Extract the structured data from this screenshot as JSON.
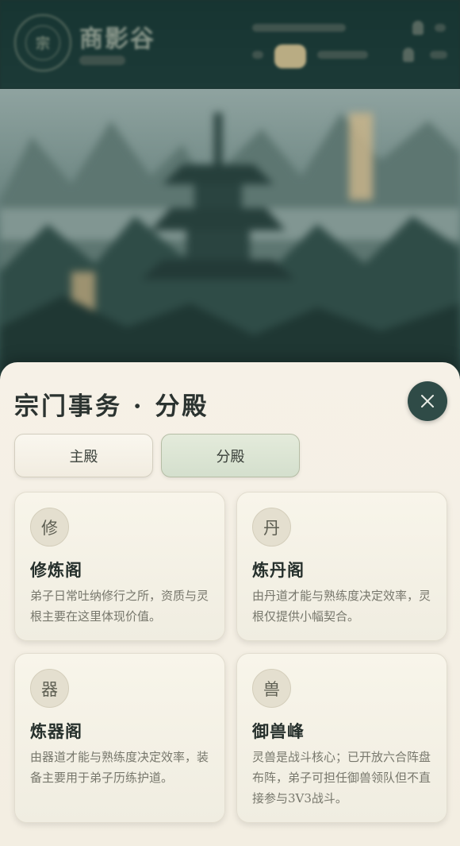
{
  "header": {
    "emblem_glyph": "宗",
    "sect_name": "商影谷"
  },
  "sheet": {
    "title": "宗门事务 · 分殿",
    "close_icon": "close-icon",
    "tabs": [
      {
        "label": "主殿",
        "active": false
      },
      {
        "label": "分殿",
        "active": true
      }
    ],
    "cards": [
      {
        "badge": "修",
        "title": "修炼阁",
        "desc": "弟子日常吐纳修行之所，资质与灵根主要在这里体现价值。"
      },
      {
        "badge": "丹",
        "title": "炼丹阁",
        "desc": "由丹道才能与熟练度决定效率，灵根仅提供小幅契合。"
      },
      {
        "badge": "器",
        "title": "炼器阁",
        "desc": "由器道才能与熟练度决定效率，装备主要用于弟子历练护道。"
      },
      {
        "badge": "兽",
        "title": "御兽峰",
        "desc": "灵兽是战斗核心；已开放六合阵盘布阵，弟子可担任御兽领队但不直接参与3V3战斗。"
      }
    ]
  },
  "colors": {
    "sheet_bg": "#f4efe4",
    "close_button": "#2f4b47",
    "active_tab": "#d9e3d2",
    "header_bg": "#183532"
  }
}
